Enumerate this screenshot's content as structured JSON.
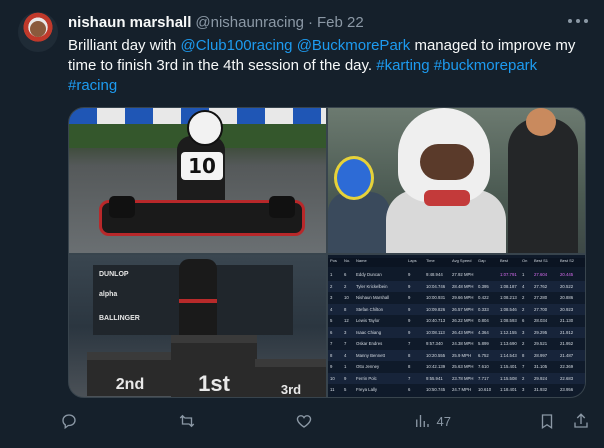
{
  "tweet": {
    "author_name": "nishaun marshall",
    "author_handle": "@nishaunracing",
    "separator": "·",
    "date": "Feb 22",
    "text_parts": [
      {
        "type": "text",
        "value": "Brilliant day with "
      },
      {
        "type": "link",
        "value": "@Club100racing"
      },
      {
        "type": "text",
        "value": " "
      },
      {
        "type": "link",
        "value": "@BuckmorePark"
      },
      {
        "type": "text",
        "value": " managed to improve my time to finish 3rd in the 4th  session of the day. "
      },
      {
        "type": "link",
        "value": "#karting"
      },
      {
        "type": "text",
        "value": " "
      },
      {
        "type": "link",
        "value": "#buckmorepark"
      },
      {
        "type": "text",
        "value": " "
      },
      {
        "type": "link",
        "value": "#racing"
      }
    ]
  },
  "media": {
    "kart_number": "10",
    "podium": {
      "second": "2nd",
      "first": "1st",
      "third": "3rd",
      "sponsors": [
        "DUNLOP",
        "alpha",
        "BALLINGER"
      ]
    },
    "results": {
      "headers": [
        "Pos",
        "No.",
        "Name",
        "Laps",
        "Time",
        "Avg Speed",
        "Gap",
        "Best",
        "On",
        "Best S1",
        "Best S2"
      ],
      "rows": [
        [
          "1",
          "6",
          "Eddy Duncan",
          "9",
          "9:48.944",
          "27.92 MPH",
          "",
          "1:07.791",
          "1",
          "27.604",
          "20.445"
        ],
        [
          "2",
          "2",
          "Tyler Krickelbein",
          "9",
          "10:04.746",
          "28.48 MPH",
          "0.395",
          "1:08.187",
          "4",
          "27.762",
          "20.522"
        ],
        [
          "3",
          "10",
          "Nishaun Marshall",
          "9",
          "10:00.931",
          "29.66 MPH",
          "0.422",
          "1:08.213",
          "2",
          "27.280",
          "20.886"
        ],
        [
          "4",
          "8",
          "Stefan Chilton",
          "9",
          "10:09.826",
          "26.57 MPH",
          "0.333",
          "1:08.546",
          "2",
          "27.700",
          "20.923"
        ],
        [
          "5",
          "12",
          "Lewis Taylor",
          "9",
          "10:40.713",
          "26.22 MPH",
          "0.804",
          "1:08.593",
          "6",
          "28.034",
          "21.130"
        ],
        [
          "6",
          "3",
          "Isaac Chiang",
          "9",
          "10:08.113",
          "26.43 MPH",
          "4.364",
          "1:12.155",
          "3",
          "29.295",
          "21.912"
        ],
        [
          "7",
          "7",
          "Oskar Endres",
          "7",
          "9:57.340",
          "24.38 MPH",
          "5.899",
          "1:13.690",
          "2",
          "29.521",
          "21.952"
        ],
        [
          "8",
          "4",
          "Manny Bennett",
          "8",
          "10:20.555",
          "25.9 MPH",
          "6.752",
          "1:14.543",
          "8",
          "28.997",
          "21.487"
        ],
        [
          "9",
          "1",
          "Otto Jenney",
          "8",
          "10:42.139",
          "25.63 MPH",
          "7.610",
          "1:15.401",
          "7",
          "31.105",
          "22.369"
        ],
        [
          "10",
          "9",
          "Ferrin Polc",
          "7",
          "9:55.941",
          "23.78 MPH",
          "7.717",
          "1:15.508",
          "2",
          "29.924",
          "22.683"
        ],
        [
          "11",
          "5",
          "Freya Lally",
          "6",
          "10:50.745",
          "24.7 MPH",
          "10.610",
          "1:18.401",
          "3",
          "31.932",
          "23.956"
        ]
      ]
    }
  },
  "actions": {
    "reply_count": "",
    "retweet_count": "",
    "like_count": "",
    "views_count": "47"
  },
  "colors": {
    "background": "#15202b",
    "link": "#1d9bf0",
    "muted": "#8b98a5",
    "text": "#f7f9f9"
  }
}
